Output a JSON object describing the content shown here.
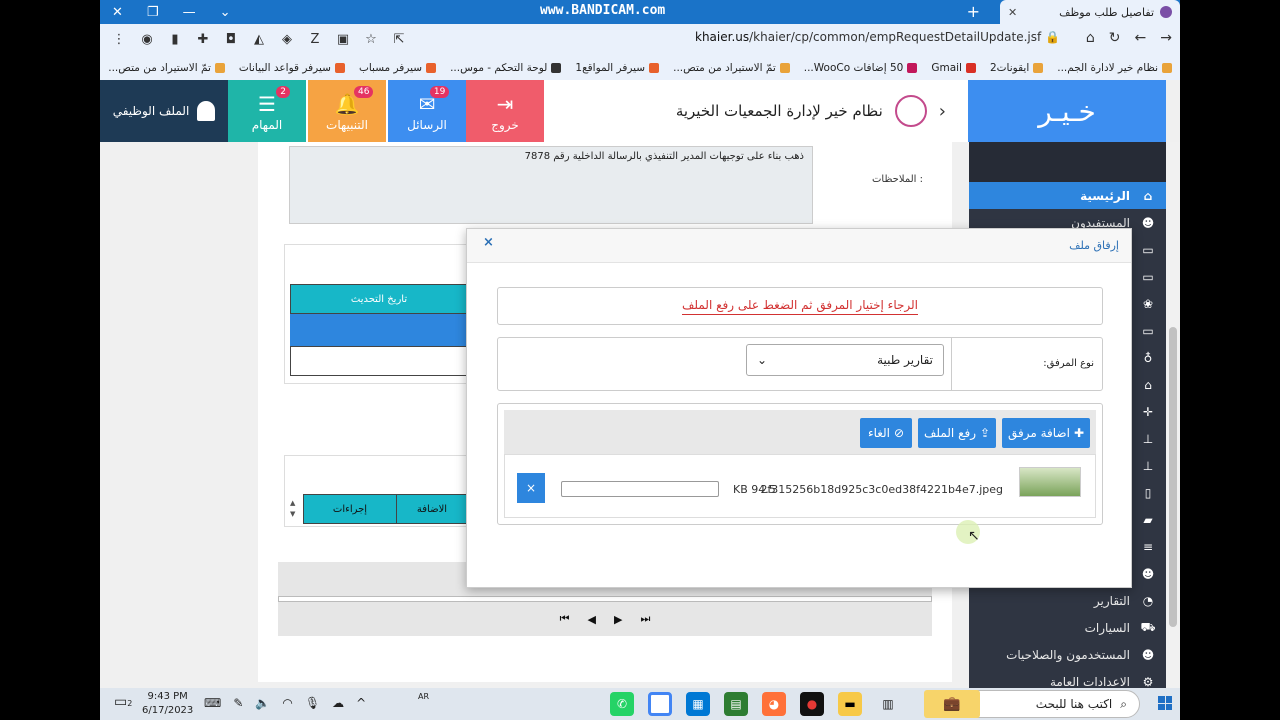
{
  "browser": {
    "tab_title": "تفاصيل طلب موظف",
    "watermark": "www.BANDICAM.com",
    "url_domain": "khaier.us",
    "url_path": "/khaier/cp/common/empRequestDetailUpdate.jsf",
    "bookmarks": [
      "نظام خير لادارة الجم...",
      "ايقونات2",
      "Gmail",
      "50 إضافات WooCo...",
      "تمّ الاستيراد من متص...",
      "سيرفر المواقع1",
      "لوحة التحكم - موس...",
      "سيرفر مسباب",
      "سيرفر قواعد البيانات",
      "تمّ الاستيراد من متص..."
    ]
  },
  "header": {
    "logo_text": "خـيـر",
    "system_name": "نظام خير لإدارة الجمعيات الخيرية",
    "buttons": [
      {
        "label": "خروج",
        "icon": "logout-icon",
        "count": "",
        "color": "#f05c6b"
      },
      {
        "label": "الرسائل",
        "icon": "envelope-icon",
        "count": "19",
        "color": "#3d8ef0"
      },
      {
        "label": "التنبيهات",
        "icon": "bell-icon",
        "count": "46",
        "color": "#f6a343"
      },
      {
        "label": "المهام",
        "icon": "tasks-icon",
        "count": "2",
        "color": "#1fb5a8"
      }
    ],
    "profile_label": "الملف الوظيفي"
  },
  "sidebar": {
    "items": [
      {
        "label": "الرئيسية",
        "icon": "home-icon",
        "active": true
      },
      {
        "label": "المستفيدون",
        "icon": "users-icon",
        "active": false
      },
      {
        "label": "",
        "icon": "money-icon",
        "active": false
      },
      {
        "label": "",
        "icon": "money-icon",
        "active": false
      },
      {
        "label": "",
        "icon": "group-icon",
        "active": false
      },
      {
        "label": "",
        "icon": "money-icon",
        "active": false
      },
      {
        "label": "",
        "icon": "microphone-icon",
        "active": false
      },
      {
        "label": "",
        "icon": "bank-icon",
        "active": false
      },
      {
        "label": "",
        "icon": "crosshair-icon",
        "active": false
      },
      {
        "label": "",
        "icon": "sitemap-icon",
        "active": false
      },
      {
        "label": "",
        "icon": "sitemap-icon",
        "active": false
      },
      {
        "label": "",
        "icon": "mobile-icon",
        "active": false
      },
      {
        "label": "",
        "icon": "folder-icon",
        "active": false
      },
      {
        "label": "",
        "icon": "list-icon",
        "active": false
      },
      {
        "label": "",
        "icon": "users-icon",
        "active": false
      },
      {
        "label": "التقارير",
        "icon": "pie-chart-icon",
        "active": false
      },
      {
        "label": "السيارات",
        "icon": "car-icon",
        "active": false
      },
      {
        "label": "المستخدمون والصلاحيات",
        "icon": "users-icon",
        "active": false
      },
      {
        "label": "الاعدادات العامة",
        "icon": "gear-icon",
        "active": false
      }
    ]
  },
  "main": {
    "notes_label": "الملاحظات :",
    "notes_text": "ذهب بناء على توجيهات المدير التنفيذي بالرسالة الداخلية رقم 7878",
    "table1_header": "تاريخ التحديث",
    "table2_headers": [
      "إجراءات",
      "الاضافة"
    ],
    "pager": [
      "⏮",
      "◀",
      "▶",
      "⏭"
    ]
  },
  "modal": {
    "title": "إرفاق ملف",
    "close": "×",
    "hint": "الرجاء إختيار المرفق ثم الضغط على رفع الملف",
    "type_label": "نوع المرفق:",
    "type_value": "تقارير طبية",
    "add_button": "اضافة مرفق",
    "upload_button": "رفع الملف",
    "cancel_button": "الغاء",
    "file": {
      "name": "2f315256b18d925c3c0ed38f4221b4e7.jpeg",
      "size": "94.5 KB",
      "progress": 0
    },
    "delete_button": "×"
  },
  "taskbar": {
    "search_placeholder": "اكتب هنا للبحث",
    "time": "9:43 PM",
    "date": "6/17/2023",
    "lang": "AR",
    "notif_count": "2"
  }
}
